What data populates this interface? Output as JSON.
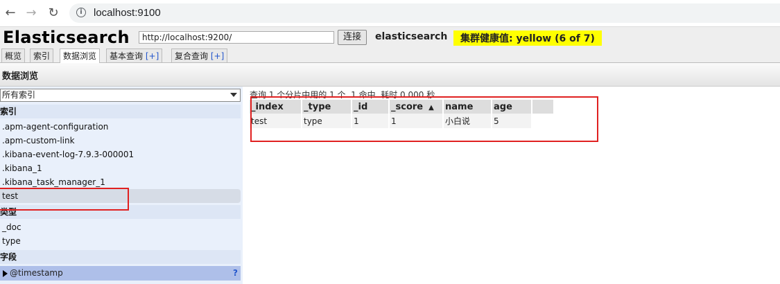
{
  "browser": {
    "url": "localhost:9100"
  },
  "header": {
    "title": "Elasticsearch",
    "connect_url": "http://localhost:9200/",
    "connect_label": "连接",
    "cluster_name": "elasticsearch",
    "health": "集群健康值: yellow (6 of 7)"
  },
  "tabs": [
    {
      "label": "概览"
    },
    {
      "label": "索引"
    },
    {
      "label": "数据浏览"
    },
    {
      "label": "基本查询",
      "plus": "[+]"
    },
    {
      "label": "复合查询",
      "plus": "[+]"
    }
  ],
  "section_title": "数据浏览",
  "sidebar": {
    "select_value": "所有索引",
    "index_heading": "索引",
    "indices": [
      ".apm-agent-configuration",
      ".apm-custom-link",
      ".kibana-event-log-7.9.3-000001",
      ".kibana_1",
      ".kibana_task_manager_1",
      "test"
    ],
    "type_heading": "类型",
    "types": [
      "_doc",
      "type"
    ],
    "field_heading": "字段",
    "field_item": "@timestamp",
    "field_help": "?"
  },
  "results": {
    "summary": "查询 1 个分片中用的 1 个. 1 命中. 耗时 0.000 秒",
    "columns": [
      "_index",
      "_type",
      "_id",
      "_score",
      "name",
      "age"
    ],
    "sort_indicator": "▲",
    "rows": [
      [
        "test",
        "type",
        "1",
        "1",
        "小白说",
        "5"
      ]
    ]
  },
  "colors": {
    "health_bg": "#ffff00",
    "highlight": "#e02020",
    "sidebar_bg": "#e9f0fb",
    "field_row_bg": "#aebfe9"
  }
}
